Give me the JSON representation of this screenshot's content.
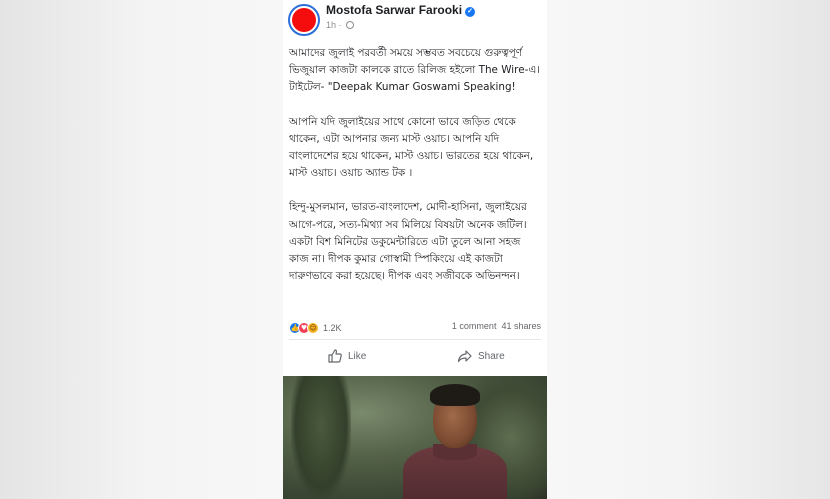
{
  "post": {
    "author": "Mostofa Sarwar Farooki",
    "time": "1h",
    "paragraphs": [
      "আমাদের জুলাই পরবর্তী সময়ে সম্ভবত সবচেয়ে গুরুত্বপূর্ণ ভিজুয়াল কাজটা কালকে রাতে রিলিজ হইলো The Wire-এ। টাইটেল- \"Deepak Kumar Goswami Speaking!",
      "আপনি যদি জুলাইয়ের সাথে কোনো ভাবে জড়িত থেকে থাকেন, এটা আপনার জন্য মাস্ট ওয়াচ। আপনি যদি বাংলাদেশের হয়ে থাকেন, মাস্ট ওয়াচ। ভারতের হয়ে থাকেন, মাস্ট ওয়াচ। ওয়াচ অ্যান্ড টক ।",
      "হিন্দু-মুসলমান, ভারত-বাংলাদেশ, মোদী-হাসিনা, জুলাইয়ের আগে-পরে, সত্য-মিথ্যা সব মিলিয়ে বিষয়টা অনেক জটিল। একটা বিশ মিনিটের ডকুমেন্টারিতে এটা তুলে আনা সহজ কাজ না। দীপক কুমার গোস্বামী স্পিকিংয়ে এই কাজটা দারুণভাবে করা হয়েছে। দীপক এবং সজীবকে অভিনন্দন।"
    ],
    "reaction_count": "1.2K",
    "comments": "1 comment",
    "shares": "41 shares"
  },
  "actions": {
    "like_label": "Like",
    "share_label": "Share"
  },
  "colors": {
    "avatar_red": "#f50c0c",
    "link_blue": "#1877f2"
  },
  "icons": [
    "verified-icon",
    "globe-icon",
    "like-reaction-icon",
    "love-reaction-icon",
    "haha-reaction-icon",
    "thumbs-up-icon",
    "share-icon"
  ]
}
